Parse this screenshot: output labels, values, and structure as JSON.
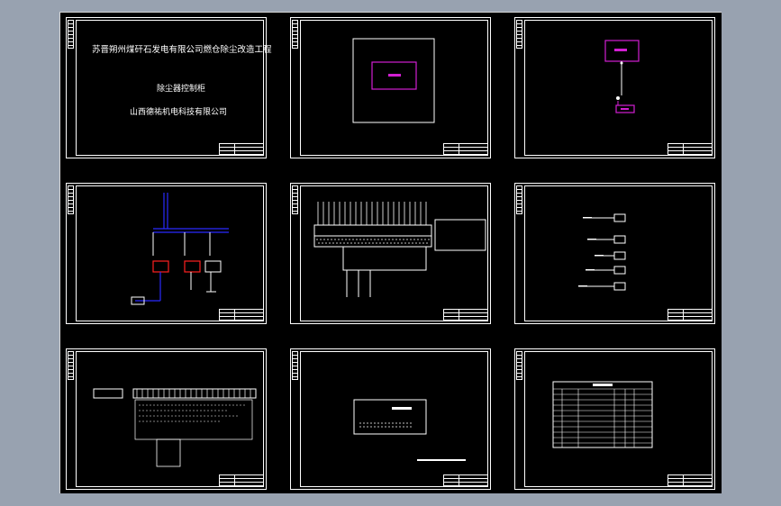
{
  "cover": {
    "title": "苏晋朔州煤矸石发电有限公司燃仓除尘改造工程",
    "subtitle": "除尘器控制柜",
    "company": "山西德祐机电科技有限公司"
  },
  "sheets": [
    {
      "id": "cover-sheet"
    },
    {
      "id": "enclosure-layout-sheet"
    },
    {
      "id": "block-diagram-sheet"
    },
    {
      "id": "power-schematic-sheet"
    },
    {
      "id": "terminal-wiring-sheet"
    },
    {
      "id": "io-signal-sheet"
    },
    {
      "id": "terminal-strip-sheet"
    },
    {
      "id": "panel-layout-sheet"
    },
    {
      "id": "bill-of-materials-sheet"
    }
  ],
  "colors": {
    "background": "#98a2b0",
    "drawing": "#000000",
    "line": "#ffffff",
    "accent_magenta": "#d21fd2",
    "accent_blue": "#2a2aff",
    "accent_red": "#ff2020"
  }
}
